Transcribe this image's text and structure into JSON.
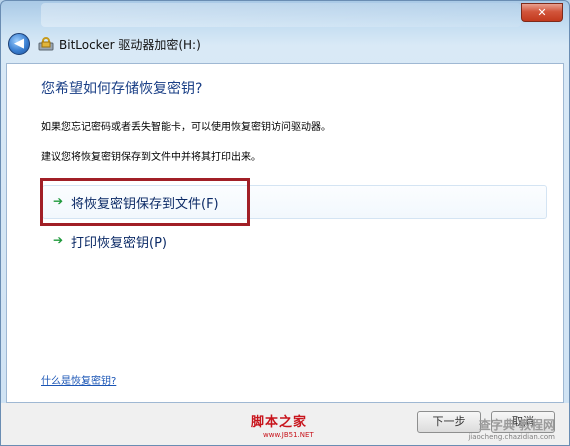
{
  "window": {
    "title": "BitLocker 驱动器加密(H:)",
    "close_glyph": "✕",
    "back_glyph": "◀"
  },
  "content": {
    "heading": "您希望如何存储恢复密钥?",
    "para1": "如果您忘记密码或者丢失智能卡，可以使用恢复密钥访问驱动器。",
    "para2": "建议您将恢复密钥保存到文件中并将其打印出来。",
    "options": [
      {
        "label": "将恢复密钥保存到文件(F)",
        "arrow": "➔"
      },
      {
        "label": "打印恢复密钥(P)",
        "arrow": "➔"
      }
    ],
    "help_link": "什么是恢复密钥?"
  },
  "footer": {
    "next_label": "下一步",
    "cancel_label": "取消"
  },
  "watermark": {
    "text": "脚本之家",
    "sub": "www.JB51.NET",
    "site2": "查字典 教程网",
    "site2_sub": "jiaocheng.chazidian.com"
  },
  "colors": {
    "heading": "#1a3f86",
    "highlight": "#a11f26",
    "arrow": "#1f9a3c"
  }
}
